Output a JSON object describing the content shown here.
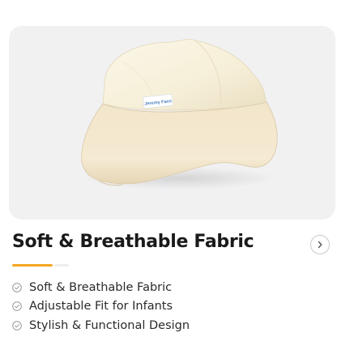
{
  "product": {
    "image_alt": "Cream infant beanie hat",
    "brand_tag": "Jeremy Fans",
    "title": "Soft & Breathable Fabric",
    "next_icon": "chevron-right-icon"
  },
  "features": [
    {
      "label": "Soft & Breathable Fabric",
      "icon": "check-circle-icon"
    },
    {
      "label": "Adjustable Fit for Infants",
      "icon": "check-circle-icon"
    },
    {
      "label": "Stylish & Functional Design",
      "icon": "check-circle-icon"
    }
  ],
  "colors": {
    "accent": "#f5a623",
    "card_background": "#f1f1f2",
    "hat_cream": "#f7f1dc",
    "hat_band": "#f3e6cc",
    "title_text": "#1a1a1a"
  }
}
